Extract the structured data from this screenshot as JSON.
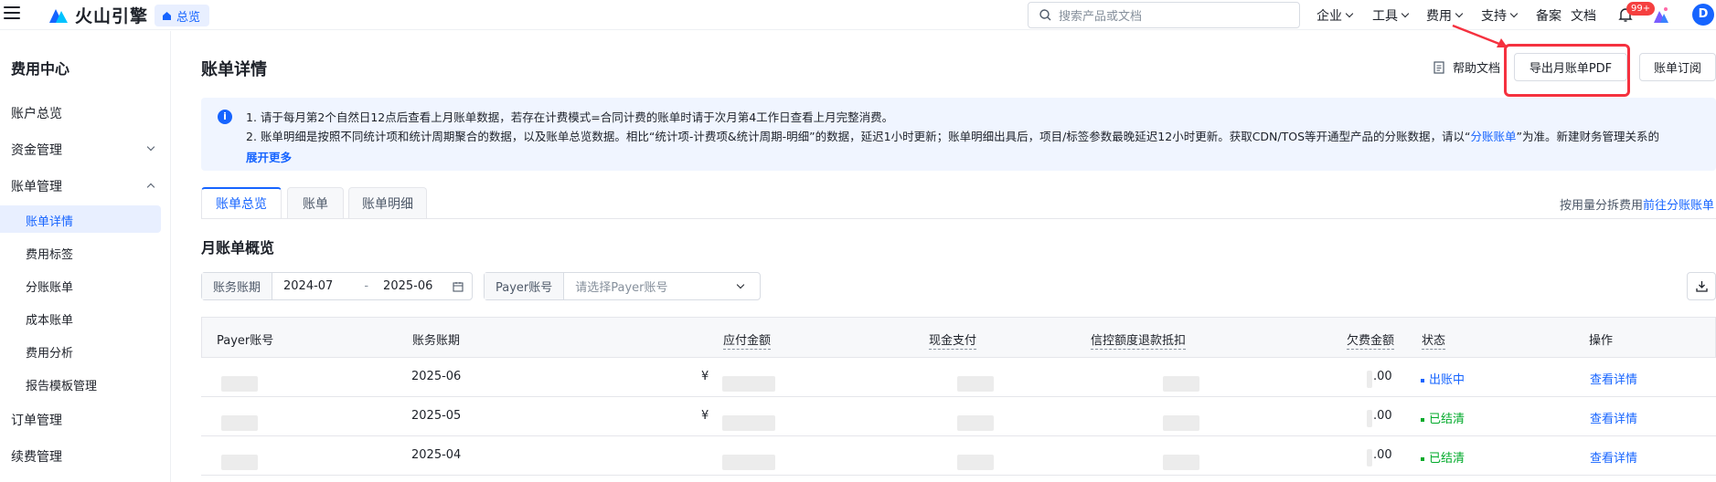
{
  "header": {
    "logo_text": "火山引擎",
    "overview_tag": "总览",
    "search_placeholder": "搜索产品或文档",
    "nav": [
      {
        "label": "企业"
      },
      {
        "label": "工具"
      },
      {
        "label": "费用"
      },
      {
        "label": "支持"
      },
      {
        "label": "备案"
      },
      {
        "label": "文档"
      }
    ],
    "notification_badge": "99+",
    "avatar_initial": "D"
  },
  "sidebar": {
    "title": "费用中心",
    "items": [
      {
        "label": "账户总览"
      },
      {
        "label": "资金管理"
      },
      {
        "label": "账单管理"
      }
    ],
    "sub_items": [
      {
        "label": "账单详情"
      },
      {
        "label": "费用标签"
      },
      {
        "label": "分账账单"
      },
      {
        "label": "成本账单"
      },
      {
        "label": "费用分析"
      },
      {
        "label": "报告模板管理"
      }
    ],
    "more_items": [
      {
        "label": "订单管理"
      },
      {
        "label": "续费管理"
      }
    ]
  },
  "page": {
    "title": "账单详情",
    "help_doc": "帮助文档",
    "export_pdf": "导出月账单PDF",
    "subscribe": "账单订阅"
  },
  "notice": {
    "line1": "1. 请于每月第2个自然日12点后查看上月账单数据，若存在计费模式=合同计费的账单时请于次月第4工作日查看上月完整消费。",
    "line2_prefix": "2. 账单明细是按照不同统计项和统计周期聚合的数据，以及账单总览数据。相比“统计项-计费项&统计周期-明细”的数据，延迟1小时更新；账单明细出具后，项目/标签参数最晚延迟12小时更新。获取CDN/TOS等开通型产品的分账数据，请以“",
    "line2_link": "分账账单",
    "line2_suffix": "”为准。新建财务管理关系的",
    "expand": "展开更多"
  },
  "tabs": [
    {
      "label": "账单总览"
    },
    {
      "label": "账单"
    },
    {
      "label": "账单明细"
    }
  ],
  "split_note": {
    "text": "按用量分拆费用",
    "link": "前往分账账单"
  },
  "section_title": "月账单概览",
  "filters": {
    "period_label": "账务账期",
    "period_start": "2024-07",
    "period_sep": "-",
    "period_end": "2025-06",
    "payer_label": "Payer账号",
    "payer_placeholder": "请选择Payer账号"
  },
  "table": {
    "headers": [
      "Payer账号",
      "账务账期",
      "应付金额",
      "现金支付",
      "信控额度退款抵扣",
      "欠费金额",
      "状态",
      "操作"
    ],
    "rows": [
      {
        "period": "2025-06",
        "currency": "¥",
        "debt_tail": ".00",
        "status": "出账中",
        "status_color": "#1664ff",
        "action": "查看详情"
      },
      {
        "period": "2025-05",
        "currency": "¥",
        "debt_tail": ".00",
        "status": "已结清",
        "status_color": "#00aa2a",
        "action": "查看详情"
      },
      {
        "period": "2025-04",
        "currency": "",
        "debt_tail": ".00",
        "status": "已结清",
        "status_color": "#00aa2a",
        "action": "查看详情"
      }
    ]
  },
  "colors": {
    "accent": "#1664ff",
    "highlight": "#f5313f",
    "badge": "#f53f3f"
  }
}
